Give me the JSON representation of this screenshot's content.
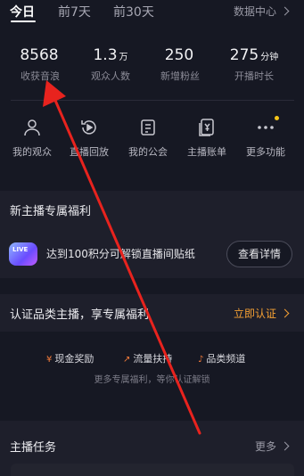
{
  "tabs": [
    {
      "label": "今日"
    },
    {
      "label": "前7天"
    },
    {
      "label": "前30天"
    }
  ],
  "data_center": "数据中心",
  "stats": [
    {
      "value": "8568",
      "unit": "",
      "label": "收获音浪"
    },
    {
      "value": "1.3",
      "unit": "万",
      "label": "观众人数"
    },
    {
      "value": "250",
      "unit": "",
      "label": "新增粉丝"
    },
    {
      "value": "275",
      "unit": "分钟",
      "label": "开播时长"
    }
  ],
  "quick_actions": [
    {
      "label": "我的观众",
      "icon": "user-icon"
    },
    {
      "label": "直播回放",
      "icon": "replay-icon"
    },
    {
      "label": "我的公会",
      "icon": "guild-icon"
    },
    {
      "label": "主播账单",
      "icon": "bill-icon"
    },
    {
      "label": "更多功能",
      "icon": "more-icon"
    }
  ],
  "new_anchor": {
    "title": "新主播专属福利",
    "badge": "LIVE",
    "text": "达到100积分可解锁直播间贴纸",
    "button": "查看详情"
  },
  "certify": {
    "title": "认证品类主播，享专属福利",
    "link": "立即认证",
    "perks": [
      {
        "icon": "yen-icon",
        "symbol": "¥",
        "label": "现金奖励"
      },
      {
        "icon": "trend-icon",
        "symbol": "↗",
        "label": "流量扶持"
      },
      {
        "icon": "tiktok-icon",
        "symbol": "♪",
        "label": "品类频道"
      }
    ],
    "note": "更多专属福利，等你认证解锁"
  },
  "tasks": {
    "title": "主播任务",
    "more": "更多"
  },
  "colors": {
    "background": "#161823",
    "card": "#1e1f2b",
    "accent_orange": "#f5a033",
    "annotation_arrow": "#e8231e"
  }
}
